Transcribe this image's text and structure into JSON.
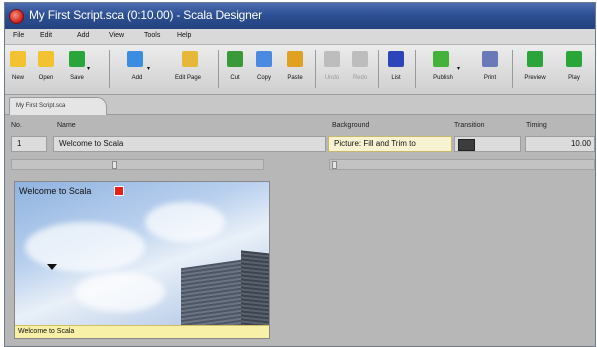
{
  "window": {
    "title": "My First Script.sca (0:10.00) - Scala Designer"
  },
  "menu": [
    "File",
    "Edit",
    "Add",
    "View",
    "Tools",
    "Help"
  ],
  "toolbar": [
    {
      "label": "New",
      "icon": "folder-new-icon",
      "color": "#f2c230"
    },
    {
      "label": "Open",
      "icon": "folder-open-icon",
      "color": "#f2c230"
    },
    {
      "label": "Save",
      "icon": "save-icon",
      "color": "#2aa53a"
    },
    {
      "label": "Add",
      "icon": "add-page-icon",
      "color": "#3a8de0"
    },
    {
      "label": "Edit Page",
      "icon": "pencil-icon",
      "color": "#e6b83a"
    },
    {
      "label": "Cut",
      "icon": "cut-icon",
      "color": "#3a9a3a"
    },
    {
      "label": "Copy",
      "icon": "copy-icon",
      "color": "#4a8ae0"
    },
    {
      "label": "Paste",
      "icon": "paste-icon",
      "color": "#e0a020"
    },
    {
      "label": "Undo",
      "icon": "undo-icon",
      "color": "#a0a0a0"
    },
    {
      "label": "Redo",
      "icon": "redo-icon",
      "color": "#a0a0a0"
    },
    {
      "label": "List",
      "icon": "list-icon",
      "color": "#2c45b8"
    },
    {
      "label": "Publish",
      "icon": "publish-icon",
      "color": "#42b23a"
    },
    {
      "label": "Print",
      "icon": "print-icon",
      "color": "#6a7ab8"
    },
    {
      "label": "Preview",
      "icon": "preview-play-icon",
      "color": "#2aa53a"
    },
    {
      "label": "Play",
      "icon": "play-icon",
      "color": "#2aa53a"
    }
  ],
  "tab": {
    "label": "My First Script.sca"
  },
  "table": {
    "headers": {
      "no": "No.",
      "name": "Name",
      "background": "Background",
      "transition": "Transition",
      "timing": "Timing"
    },
    "row": {
      "no": "1",
      "name": "Welcome to Scala",
      "background": "Picture: Fill and Trim to",
      "timing": "10.00"
    }
  },
  "preview": {
    "title": "Welcome to Scala",
    "caption": "Welcome to Scala"
  }
}
